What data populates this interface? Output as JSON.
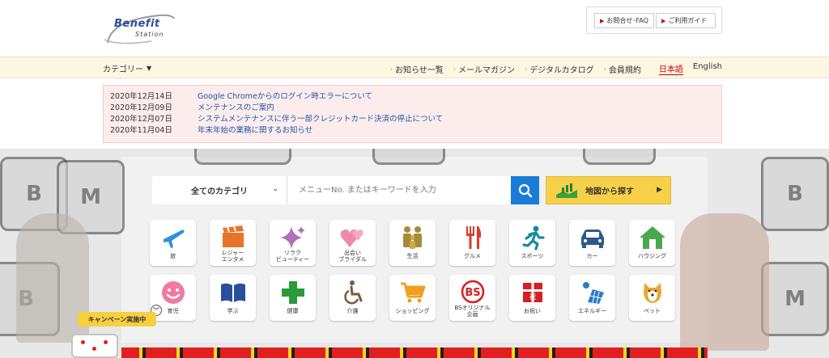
{
  "header": {
    "logo_line1": "Benefit",
    "logo_line2": "Station",
    "help_faq": "お問合せ･FAQ",
    "help_guide": "ご利用ガイド"
  },
  "nav": {
    "category_label": "カテゴリー",
    "links": [
      "お知らせ一覧",
      "メールマガジン",
      "デジタルカタログ",
      "会員規約"
    ],
    "lang_ja": "日本語",
    "lang_en": "English"
  },
  "news": [
    {
      "date": "2020年12月14日",
      "title": "Google Chromeからのログイン時エラーについて"
    },
    {
      "date": "2020年12月09日",
      "title": "メンテナンスのご案内"
    },
    {
      "date": "2020年12月07日",
      "title": "システムメンテナンスに伴う一部クレジットカード決済の停止について"
    },
    {
      "date": "2020年11月04日",
      "title": "年末年始の業務に関するお知らせ"
    }
  ],
  "search": {
    "category_selected": "全てのカテゴリ",
    "placeholder": "メニューNo. またはキーワードを入力",
    "map_button": "地図から探す"
  },
  "categories": {
    "row1": [
      {
        "label": "旅",
        "icon": "airplane-icon"
      },
      {
        "label": "レジャー\nエンタメ",
        "icon": "clapperboard-icon"
      },
      {
        "label": "リラク\nビューティー",
        "icon": "sparkle-icon"
      },
      {
        "label": "出会い\nブライダル",
        "icon": "hearts-icon"
      },
      {
        "label": "生活",
        "icon": "family-icon"
      },
      {
        "label": "グルメ",
        "icon": "fork-knife-icon"
      },
      {
        "label": "スポーツ",
        "icon": "runner-icon"
      },
      {
        "label": "カー",
        "icon": "car-icon"
      },
      {
        "label": "ハウジング",
        "icon": "house-icon"
      }
    ],
    "row2": [
      {
        "label": "育児",
        "icon": "smiley-icon"
      },
      {
        "label": "学ぶ",
        "icon": "book-icon"
      },
      {
        "label": "健康",
        "icon": "cross-icon"
      },
      {
        "label": "介護",
        "icon": "wheelchair-icon"
      },
      {
        "label": "ショッピング",
        "icon": "cart-icon"
      },
      {
        "label": "BSオリジナル\n企画",
        "icon": "bs-icon"
      },
      {
        "label": "お祝い",
        "icon": "gift-icon"
      },
      {
        "label": "エネルギー",
        "icon": "solar-panel-icon"
      },
      {
        "label": "ペット",
        "icon": "dog-icon"
      }
    ]
  },
  "campaign": {
    "label": "キャンペーン実施中"
  },
  "colors": {
    "accent_blue": "#1a7cd8",
    "nav_bg": "#fdf6e3",
    "news_bg": "#fdecec",
    "map_button": "#f7d04a"
  }
}
